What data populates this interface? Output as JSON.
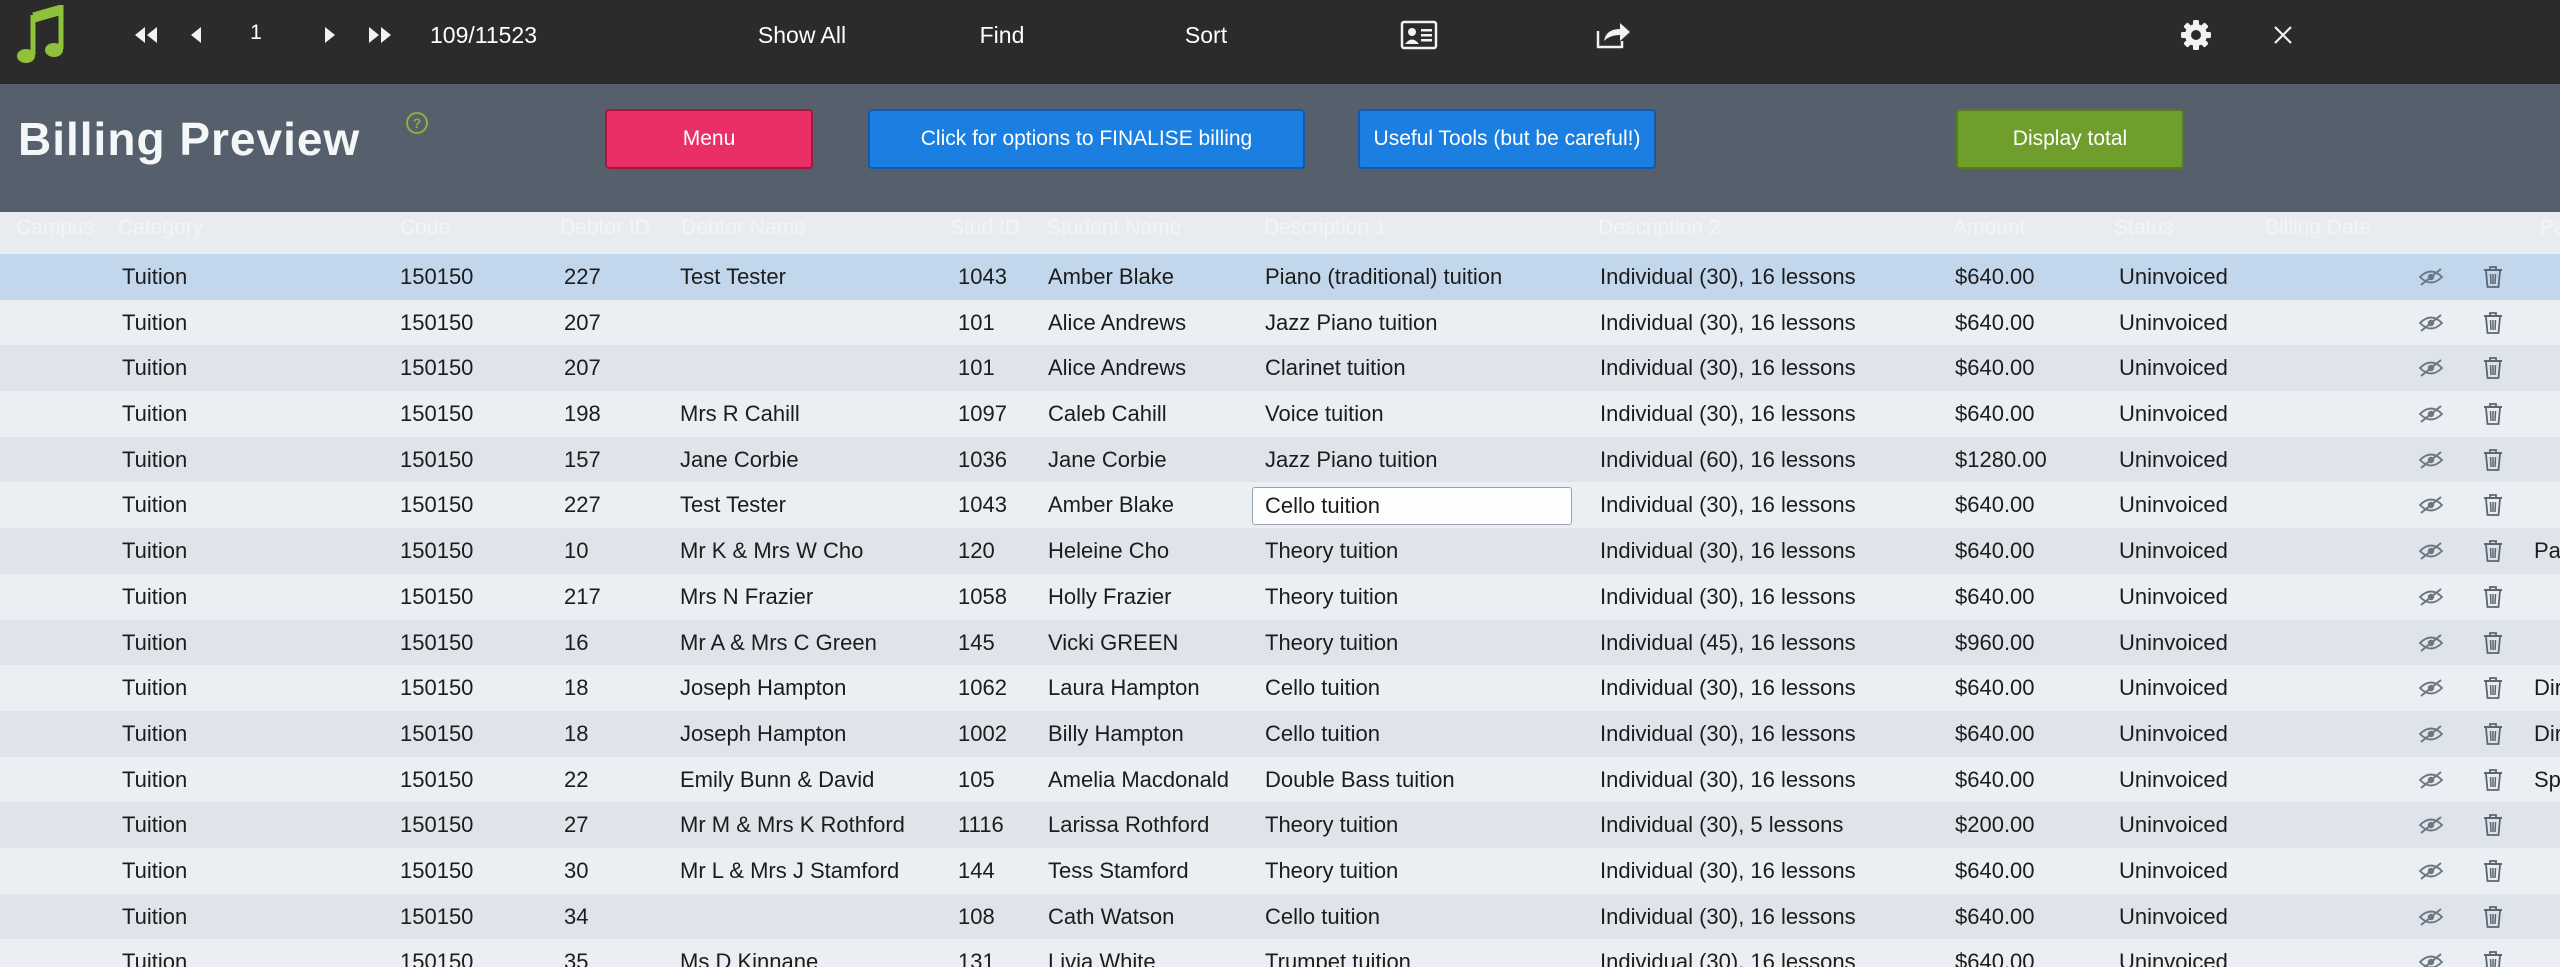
{
  "toolbar": {
    "record_number": "1",
    "record_count": "109/11523",
    "show_all_label": "Show All",
    "find_label": "Find",
    "sort_label": "Sort"
  },
  "header": {
    "title": "Billing Preview",
    "help_symbol": "?",
    "menu_label": "Menu",
    "finalise_label": "Click for options to FINALISE billing",
    "tools_label": "Useful Tools (but be careful!)",
    "display_total_label": "Display total"
  },
  "columns": [
    "Campus",
    "Category",
    "Code",
    "Debtor ID",
    "Debtor Name",
    "Stud ID",
    "Student Name",
    "Description 1",
    "Description 2",
    "Amount",
    "Status",
    "Billing Date",
    "Pa"
  ],
  "rows": [
    {
      "campus": "",
      "category": "Tuition",
      "code": "150150",
      "debtor_id": "227",
      "debtor_name": "Test Tester",
      "stud_id": "1043",
      "student_name": "Amber Blake",
      "desc1": "Piano (traditional) tuition",
      "desc2": "Individual (30), 16 lessons",
      "amount": "$640.00",
      "status": "Uninvoiced",
      "billing_date": "",
      "extra": ""
    },
    {
      "campus": "",
      "category": "Tuition",
      "code": "150150",
      "debtor_id": "207",
      "debtor_name": "",
      "stud_id": "101",
      "student_name": "Alice Andrews",
      "desc1": "Jazz Piano tuition",
      "desc2": "Individual (30), 16 lessons",
      "amount": "$640.00",
      "status": "Uninvoiced",
      "billing_date": "",
      "extra": ""
    },
    {
      "campus": "",
      "category": "Tuition",
      "code": "150150",
      "debtor_id": "207",
      "debtor_name": "",
      "stud_id": "101",
      "student_name": "Alice Andrews",
      "desc1": "Clarinet tuition",
      "desc2": "Individual (30), 16 lessons",
      "amount": "$640.00",
      "status": "Uninvoiced",
      "billing_date": "",
      "extra": ""
    },
    {
      "campus": "",
      "category": "Tuition",
      "code": "150150",
      "debtor_id": "198",
      "debtor_name": "Mrs R Cahill",
      "stud_id": "1097",
      "student_name": "Caleb Cahill",
      "desc1": "Voice tuition",
      "desc2": "Individual (30), 16 lessons",
      "amount": "$640.00",
      "status": "Uninvoiced",
      "billing_date": "",
      "extra": ""
    },
    {
      "campus": "",
      "category": "Tuition",
      "code": "150150",
      "debtor_id": "157",
      "debtor_name": "Jane Corbie",
      "stud_id": "1036",
      "student_name": "Jane Corbie",
      "desc1": "Jazz Piano tuition",
      "desc2": "Individual (60), 16 lessons",
      "amount": "$1280.00",
      "status": "Uninvoiced",
      "billing_date": "",
      "extra": ""
    },
    {
      "campus": "",
      "category": "Tuition",
      "code": "150150",
      "debtor_id": "227",
      "debtor_name": "Test Tester",
      "stud_id": "1043",
      "student_name": "Amber Blake",
      "desc1": "Cello tuition",
      "desc2": "Individual (30), 16 lessons",
      "amount": "$640.00",
      "status": "Uninvoiced",
      "billing_date": "",
      "extra": ""
    },
    {
      "campus": "",
      "category": "Tuition",
      "code": "150150",
      "debtor_id": "10",
      "debtor_name": "Mr K & Mrs W Cho",
      "stud_id": "120",
      "student_name": "Heleine Cho",
      "desc1": "Theory tuition",
      "desc2": "Individual (30), 16 lessons",
      "amount": "$640.00",
      "status": "Uninvoiced",
      "billing_date": "",
      "extra": "Pa"
    },
    {
      "campus": "",
      "category": "Tuition",
      "code": "150150",
      "debtor_id": "217",
      "debtor_name": "Mrs N Frazier",
      "stud_id": "1058",
      "student_name": "Holly Frazier",
      "desc1": "Theory tuition",
      "desc2": "Individual (30), 16 lessons",
      "amount": "$640.00",
      "status": "Uninvoiced",
      "billing_date": "",
      "extra": ""
    },
    {
      "campus": "",
      "category": "Tuition",
      "code": "150150",
      "debtor_id": "16",
      "debtor_name": "Mr A & Mrs C Green",
      "stud_id": "145",
      "student_name": "Vicki GREEN",
      "desc1": "Theory tuition",
      "desc2": "Individual (45), 16 lessons",
      "amount": "$960.00",
      "status": "Uninvoiced",
      "billing_date": "",
      "extra": ""
    },
    {
      "campus": "",
      "category": "Tuition",
      "code": "150150",
      "debtor_id": "18",
      "debtor_name": "Joseph Hampton",
      "stud_id": "1062",
      "student_name": "Laura Hampton",
      "desc1": "Cello tuition",
      "desc2": "Individual (30), 16 lessons",
      "amount": "$640.00",
      "status": "Uninvoiced",
      "billing_date": "",
      "extra": "Dir"
    },
    {
      "campus": "",
      "category": "Tuition",
      "code": "150150",
      "debtor_id": "18",
      "debtor_name": "Joseph Hampton",
      "stud_id": "1002",
      "student_name": "Billy Hampton",
      "desc1": "Cello tuition",
      "desc2": "Individual (30), 16 lessons",
      "amount": "$640.00",
      "status": "Uninvoiced",
      "billing_date": "",
      "extra": "Dir"
    },
    {
      "campus": "",
      "category": "Tuition",
      "code": "150150",
      "debtor_id": "22",
      "debtor_name": "Emily Bunn & David",
      "stud_id": "105",
      "student_name": "Amelia Macdonald",
      "desc1": "Double Bass tuition",
      "desc2": "Individual (30), 16 lessons",
      "amount": "$640.00",
      "status": "Uninvoiced",
      "billing_date": "",
      "extra": "Sp"
    },
    {
      "campus": "",
      "category": "Tuition",
      "code": "150150",
      "debtor_id": "27",
      "debtor_name": "Mr M & Mrs K Rothford",
      "stud_id": "1116",
      "student_name": "Larissa Rothford",
      "desc1": "Theory tuition",
      "desc2": "Individual (30), 5 lessons",
      "amount": "$200.00",
      "status": "Uninvoiced",
      "billing_date": "",
      "extra": ""
    },
    {
      "campus": "",
      "category": "Tuition",
      "code": "150150",
      "debtor_id": "30",
      "debtor_name": "Mr L & Mrs J Stamford",
      "stud_id": "144",
      "student_name": "Tess Stamford",
      "desc1": "Theory tuition",
      "desc2": "Individual (30), 16 lessons",
      "amount": "$640.00",
      "status": "Uninvoiced",
      "billing_date": "",
      "extra": ""
    },
    {
      "campus": "",
      "category": "Tuition",
      "code": "150150",
      "debtor_id": "34",
      "debtor_name": "",
      "stud_id": "108",
      "student_name": "Cath Watson",
      "desc1": "Cello tuition",
      "desc2": "Individual (30), 16 lessons",
      "amount": "$640.00",
      "status": "Uninvoiced",
      "billing_date": "",
      "extra": ""
    },
    {
      "campus": "",
      "category": "Tuition",
      "code": "150150",
      "debtor_id": "35",
      "debtor_name": "Ms D Kinnane",
      "stud_id": "131",
      "student_name": "Livia White",
      "desc1": "Trumpet tuition",
      "desc2": "Individual (30), 16 lessons",
      "amount": "$640.00",
      "status": "Uninvoiced",
      "billing_date": "",
      "extra": ""
    }
  ],
  "selected_row": 0,
  "active_cell_row": 5,
  "colors": {
    "toolbar_bg": "#2b2b2b",
    "header_bg": "#55606c",
    "menu_button": "#ea2f66",
    "blue_button": "#1a7fe0",
    "green_button": "#6f9e2c",
    "selected_row": "#c3d7ec",
    "logo_green": "#8fc23a"
  },
  "icons": {
    "logo": "music-note-icon",
    "first": "first-record-icon",
    "prev": "previous-record-icon",
    "next": "next-record-icon",
    "last": "last-record-icon",
    "view": "contact-card-icon",
    "share": "share-icon",
    "settings": "gear-icon",
    "close": "close-icon",
    "row_hide": "eye-slash-icon",
    "row_delete": "trash-icon"
  }
}
